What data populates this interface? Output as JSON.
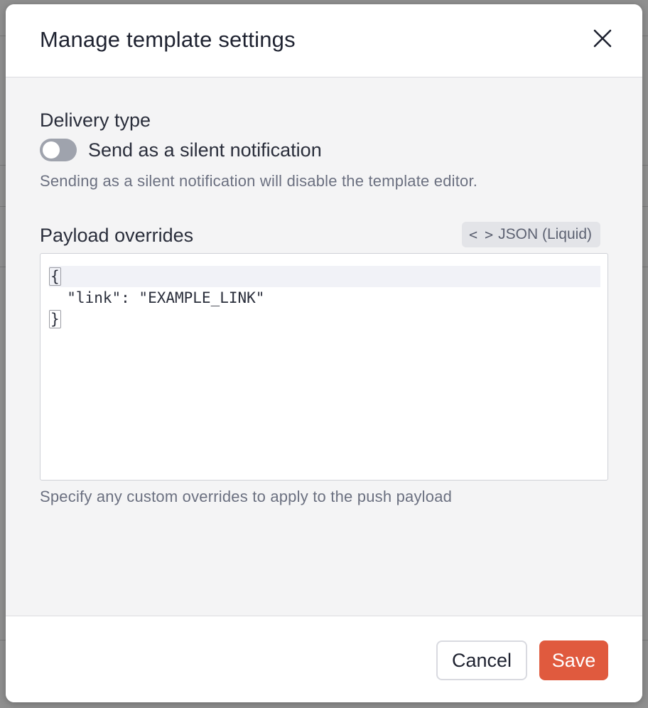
{
  "dialog": {
    "title": "Manage template settings",
    "close_icon": "close-icon"
  },
  "delivery": {
    "section_label": "Delivery type",
    "toggle_label": "Send as a silent notification",
    "toggle_on": false,
    "help_text": "Sending as a silent notification will disable the template editor."
  },
  "payload": {
    "section_label": "Payload overrides",
    "format_icon": "code-icon",
    "format_icon_glyph": "< >",
    "format_label": "JSON (Liquid)",
    "editor_lines": [
      "{",
      "  \"link\": \"EXAMPLE_LINK\"",
      "}"
    ],
    "help_text": "Specify any custom overrides to apply to the push payload"
  },
  "footer": {
    "cancel_label": "Cancel",
    "save_label": "Save"
  },
  "colors": {
    "primary": "#e05a3e",
    "toggle_off": "#9fa3ad"
  }
}
